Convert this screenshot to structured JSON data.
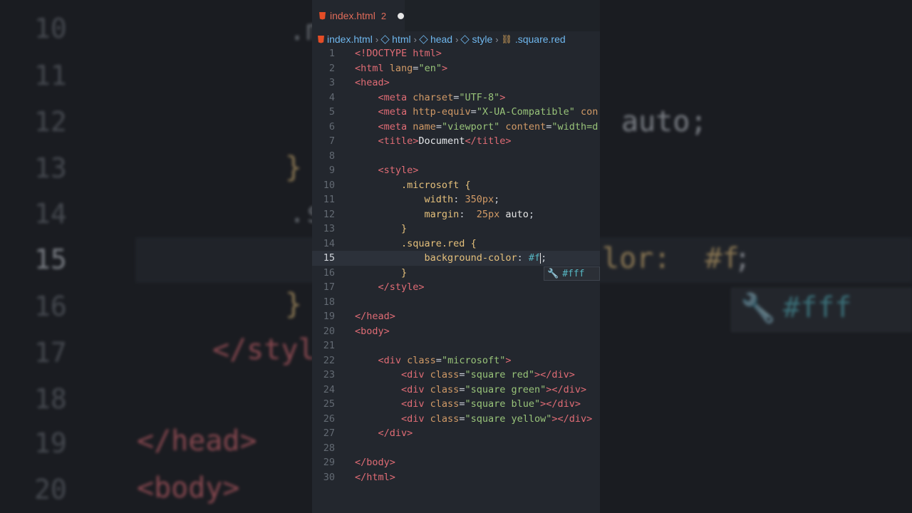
{
  "tab": {
    "filename": "index.html",
    "problem_count": "2"
  },
  "breadcrumb": [
    "index.html",
    "html",
    "head",
    "style",
    ".square.red"
  ],
  "suggestion": "#fff",
  "background": {
    "line_numbers": [
      "10",
      "11",
      "12",
      "13",
      "14",
      "15",
      "16",
      "17",
      "18",
      "19",
      "20"
    ],
    "fragments": {
      "auto": "auto;",
      "color": "lor:  #f",
      "semi": ";",
      "suggest": "#fff",
      "style_close": "</styl",
      "head_close": "</head>",
      "body_open": "<body>",
      "brace": "}",
      "dot_m": ".m",
      "dot_s": ".s"
    }
  },
  "code_lines": [
    {
      "n": "1",
      "segments": [
        [
          "t-doctype",
          "<!DOCTYPE html>"
        ]
      ]
    },
    {
      "n": "2",
      "segments": [
        [
          "t-tag",
          "<html "
        ],
        [
          "t-attr",
          "lang"
        ],
        [
          "t-punct",
          "="
        ],
        [
          "t-str",
          "\"en\""
        ],
        [
          "t-tag",
          ">"
        ]
      ]
    },
    {
      "n": "3",
      "segments": [
        [
          "t-tag",
          "<head>"
        ]
      ]
    },
    {
      "n": "4",
      "segments": [
        [
          "t-text",
          "    "
        ],
        [
          "t-tag",
          "<meta "
        ],
        [
          "t-attr",
          "charset"
        ],
        [
          "t-punct",
          "="
        ],
        [
          "t-str",
          "\"UTF-8\""
        ],
        [
          "t-tag",
          ">"
        ]
      ]
    },
    {
      "n": "5",
      "segments": [
        [
          "t-text",
          "    "
        ],
        [
          "t-tag",
          "<meta "
        ],
        [
          "t-attr",
          "http-equiv"
        ],
        [
          "t-punct",
          "="
        ],
        [
          "t-str",
          "\"X-UA-Compatible\""
        ],
        [
          "t-attr",
          " con"
        ]
      ]
    },
    {
      "n": "6",
      "segments": [
        [
          "t-text",
          "    "
        ],
        [
          "t-tag",
          "<meta "
        ],
        [
          "t-attr",
          "name"
        ],
        [
          "t-punct",
          "="
        ],
        [
          "t-str",
          "\"viewport\""
        ],
        [
          "t-attr",
          " content"
        ],
        [
          "t-punct",
          "="
        ],
        [
          "t-str",
          "\"width=d"
        ]
      ]
    },
    {
      "n": "7",
      "segments": [
        [
          "t-text",
          "    "
        ],
        [
          "t-tag",
          "<title>"
        ],
        [
          "t-text",
          "Document"
        ],
        [
          "t-tag",
          "</title>"
        ]
      ]
    },
    {
      "n": "8",
      "segments": []
    },
    {
      "n": "9",
      "segments": [
        [
          "t-text",
          "    "
        ],
        [
          "t-tag",
          "<style>"
        ]
      ]
    },
    {
      "n": "10",
      "segments": [
        [
          "t-text",
          "        "
        ],
        [
          "t-sel",
          ".microsoft "
        ],
        [
          "t-brace",
          "{"
        ]
      ]
    },
    {
      "n": "11",
      "segments": [
        [
          "t-text",
          "            "
        ],
        [
          "t-prop",
          "width"
        ],
        [
          "t-punct",
          ": "
        ],
        [
          "t-num",
          "350px"
        ],
        [
          "t-punct",
          ";"
        ]
      ]
    },
    {
      "n": "12",
      "segments": [
        [
          "t-text",
          "            "
        ],
        [
          "t-prop",
          "margin"
        ],
        [
          "t-punct",
          ":  "
        ],
        [
          "t-num",
          "25px "
        ],
        [
          "t-kw",
          "auto"
        ],
        [
          "t-punct",
          ";"
        ]
      ]
    },
    {
      "n": "13",
      "segments": [
        [
          "t-text",
          "        "
        ],
        [
          "t-brace",
          "}"
        ]
      ]
    },
    {
      "n": "14",
      "segments": [
        [
          "t-text",
          "        "
        ],
        [
          "t-sel",
          ".square.red "
        ],
        [
          "t-brace",
          "{"
        ]
      ]
    },
    {
      "n": "15",
      "segments": [
        [
          "t-text",
          "            "
        ],
        [
          "t-prop",
          "background-color"
        ],
        [
          "t-punct",
          ": "
        ],
        [
          "t-hex",
          "#f"
        ],
        [
          "cursor",
          ""
        ],
        [
          "t-punct",
          ";"
        ]
      ]
    },
    {
      "n": "16",
      "segments": [
        [
          "t-text",
          "        "
        ],
        [
          "t-brace",
          "}"
        ]
      ]
    },
    {
      "n": "17",
      "segments": [
        [
          "t-text",
          "    "
        ],
        [
          "t-tag",
          "</style>"
        ]
      ]
    },
    {
      "n": "18",
      "segments": []
    },
    {
      "n": "19",
      "segments": [
        [
          "t-tag",
          "</head>"
        ]
      ]
    },
    {
      "n": "20",
      "segments": [
        [
          "t-tag",
          "<body>"
        ]
      ]
    },
    {
      "n": "21",
      "segments": []
    },
    {
      "n": "22",
      "segments": [
        [
          "t-text",
          "    "
        ],
        [
          "t-tag",
          "<div "
        ],
        [
          "t-attr",
          "class"
        ],
        [
          "t-punct",
          "="
        ],
        [
          "t-str",
          "\"microsoft\""
        ],
        [
          "t-tag",
          ">"
        ]
      ]
    },
    {
      "n": "23",
      "segments": [
        [
          "t-text",
          "        "
        ],
        [
          "t-tag",
          "<div "
        ],
        [
          "t-attr",
          "class"
        ],
        [
          "t-punct",
          "="
        ],
        [
          "t-str",
          "\"square red\""
        ],
        [
          "t-tag",
          "></div>"
        ]
      ]
    },
    {
      "n": "24",
      "segments": [
        [
          "t-text",
          "        "
        ],
        [
          "t-tag",
          "<div "
        ],
        [
          "t-attr",
          "class"
        ],
        [
          "t-punct",
          "="
        ],
        [
          "t-str",
          "\"square green\""
        ],
        [
          "t-tag",
          "></div>"
        ]
      ]
    },
    {
      "n": "25",
      "segments": [
        [
          "t-text",
          "        "
        ],
        [
          "t-tag",
          "<div "
        ],
        [
          "t-attr",
          "class"
        ],
        [
          "t-punct",
          "="
        ],
        [
          "t-str",
          "\"square blue\""
        ],
        [
          "t-tag",
          "></div>"
        ]
      ]
    },
    {
      "n": "26",
      "segments": [
        [
          "t-text",
          "        "
        ],
        [
          "t-tag",
          "<div "
        ],
        [
          "t-attr",
          "class"
        ],
        [
          "t-punct",
          "="
        ],
        [
          "t-str",
          "\"square yellow\""
        ],
        [
          "t-tag",
          "></div>"
        ]
      ]
    },
    {
      "n": "27",
      "segments": [
        [
          "t-text",
          "    "
        ],
        [
          "t-tag",
          "</div>"
        ]
      ]
    },
    {
      "n": "28",
      "segments": []
    },
    {
      "n": "29",
      "segments": [
        [
          "t-tag",
          "</body>"
        ]
      ]
    },
    {
      "n": "30",
      "segments": [
        [
          "t-tag",
          "</html>"
        ]
      ]
    }
  ],
  "active_line": "15",
  "colors": {
    "editor_bg": "#23272e",
    "tab_accent": "#e06c5a",
    "breadcrumb": "#6fb7ee"
  }
}
